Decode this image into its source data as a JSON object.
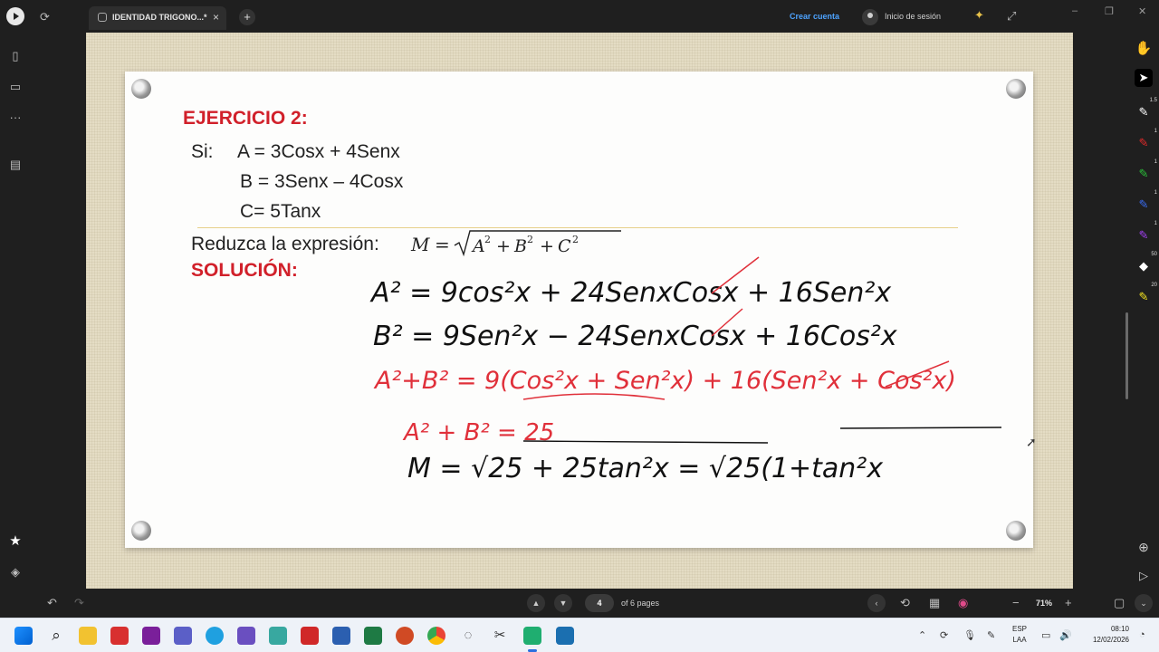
{
  "titlebar": {
    "tab_title": "IDENTIDAD TRIGONO...*",
    "crear_cuenta": "Crear cuenta",
    "inicio_sesion": "Inicio de sesión"
  },
  "sheet": {
    "exercise_title": "EJERCICIO 2:",
    "si_label": "Si:",
    "eq_a": "A = 3Cosx + 4Senx",
    "eq_b": "B = 3Senx – 4Cosx",
    "eq_c": "C= 5Tanx",
    "prompt": "Reduzca la expresión:",
    "solution_label": "SOLUCIÓN:"
  },
  "handwriting": {
    "line1": "A² = 9cos²x + 24SenxCosx + 16Sen²x",
    "line2": "B² = 9Sen²x − 24SenxCosx + 16Cos²x",
    "line3": "A²+B² = 9(Cos²x + Sen²x) + 16(Sen²x + Cos²x)",
    "line4": "A² + B² = 25",
    "line5": "M = √25 + 25tan²x = √25(1+tan²x"
  },
  "rightrail": {
    "badge_1": "1.5",
    "badge_red": "1",
    "badge_green": "1",
    "badge_blue": "1",
    "badge_purple": "1",
    "badge_eraser": "50",
    "badge_highlighter": "20"
  },
  "bottombar": {
    "page_current": "4",
    "page_count": "of 6 pages",
    "zoom": "71%"
  },
  "taskbar": {
    "lang_1": "ESP",
    "lang_2": "LAA",
    "time": "08:10",
    "date": "12/02/2026"
  },
  "colors": {
    "accent_red": "#d1202a",
    "ink_black": "#111111",
    "ink_red": "#e0303a",
    "link_blue": "#4da3ff"
  }
}
